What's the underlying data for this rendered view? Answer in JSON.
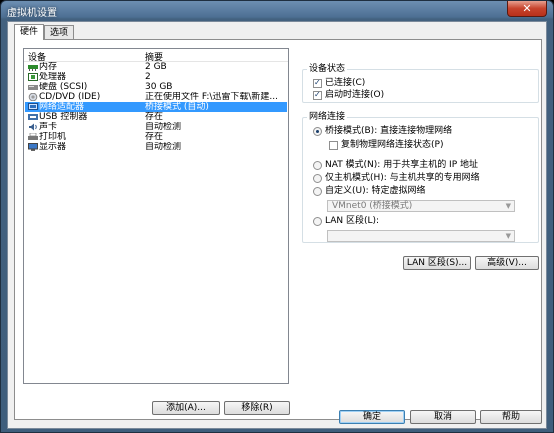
{
  "window": {
    "title": "虚拟机设置",
    "close": "✕"
  },
  "tabs": [
    {
      "label": "硬件"
    },
    {
      "label": "选项"
    }
  ],
  "device_list": {
    "columns": [
      "设备",
      "摘要"
    ],
    "rows": [
      {
        "name": "内存",
        "summary": "2 GB",
        "icon": "memory-icon"
      },
      {
        "name": "处理器",
        "summary": "2",
        "icon": "processor-icon"
      },
      {
        "name": "硬盘 (SCSI)",
        "summary": "30 GB",
        "icon": "hard-disk-icon"
      },
      {
        "name": "CD/DVD (IDE)",
        "summary": "正在使用文件 F:\\迅雷下载\\新建...",
        "icon": "cd-dvd-icon"
      },
      {
        "name": "网络适配器",
        "summary": "桥接模式 (自动)",
        "icon": "network-adapter-icon",
        "selected": true
      },
      {
        "name": "USB 控制器",
        "summary": "存在",
        "icon": "usb-icon"
      },
      {
        "name": "声卡",
        "summary": "自动检测",
        "icon": "sound-card-icon"
      },
      {
        "name": "打印机",
        "summary": "存在",
        "icon": "printer-icon"
      },
      {
        "name": "显示器",
        "summary": "自动检测",
        "icon": "display-icon"
      }
    ],
    "add_label": "添加(A)...",
    "remove_label": "移除(R)"
  },
  "device_status": {
    "title": "设备状态",
    "connected": {
      "label": "已连接(C)",
      "checked": true
    },
    "connect_on_power_on": {
      "label": "启动时连接(O)",
      "checked": true
    }
  },
  "network_connection": {
    "title": "网络连接",
    "bridged": {
      "label": "桥接模式(B): 直接连接物理网络",
      "selected": true
    },
    "replicate": {
      "label": "复制物理网络连接状态(P)",
      "checked": false
    },
    "nat": {
      "label": "NAT 模式(N): 用于共享主机的 IP 地址",
      "selected": false
    },
    "host_only": {
      "label": "仅主机模式(H): 与主机共享的专用网络",
      "selected": false
    },
    "custom": {
      "label": "自定义(U): 特定虚拟网络",
      "selected": false
    },
    "custom_value": "VMnet0 (桥接模式)",
    "lan_segment": {
      "label": "LAN 区段(L):",
      "selected": false
    },
    "lan_value": ""
  },
  "actions": {
    "lan_segments": "LAN 区段(S)...",
    "advanced": "高级(V)..."
  },
  "footer": {
    "ok": "确定",
    "cancel": "取消",
    "help": "帮助"
  },
  "colors": {
    "selection": "#3399ff",
    "titlebar": "#4d6f93",
    "close": "#c7432c"
  }
}
